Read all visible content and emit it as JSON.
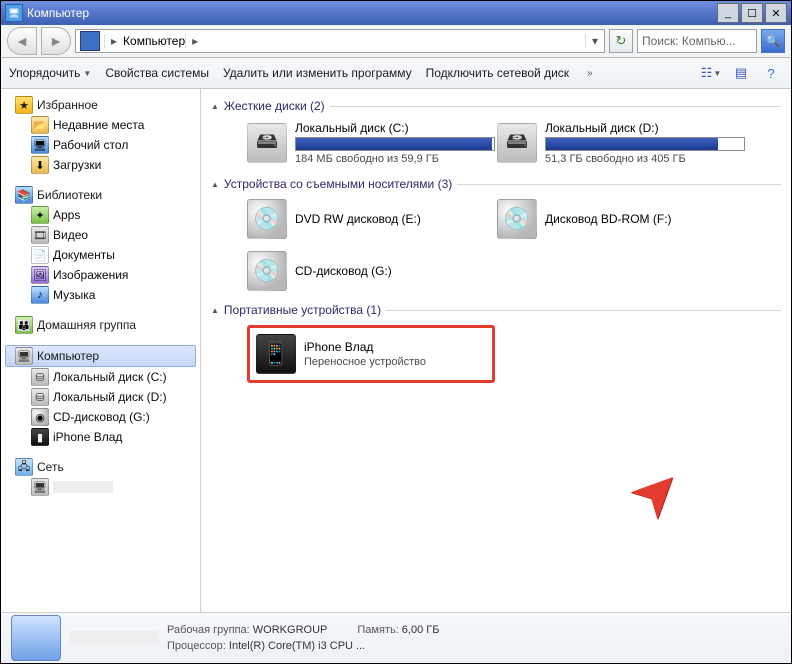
{
  "window": {
    "title": "Компьютер"
  },
  "address": {
    "text": "Компьютер",
    "search_placeholder": "Поиск: Компью..."
  },
  "toolbar": {
    "organize": "Упорядочить",
    "sysprops": "Свойства системы",
    "uninstall": "Удалить или изменить программу",
    "mapdrive": "Подключить сетевой диск"
  },
  "sidebar": {
    "fav_header": "Избранное",
    "fav_items": [
      "Недавние места",
      "Рабочий стол",
      "Загрузки"
    ],
    "lib_header": "Библиотеки",
    "lib_items": [
      "Apps",
      "Видео",
      "Документы",
      "Изображения",
      "Музыка"
    ],
    "homegroup": "Домашняя группа",
    "computer": "Компьютер",
    "drives": [
      "Локальный диск (C:)",
      "Локальный диск (D:)",
      "CD-дисковод (G:)",
      "iPhone Влад"
    ],
    "network": "Сеть"
  },
  "sections": {
    "hdd": "Жесткие диски (2)",
    "removable": "Устройства со съемными носителями (3)",
    "portable": "Портативные устройства (1)"
  },
  "hdds": [
    {
      "name": "Локальный диск (C:)",
      "free_text": "184 МБ свободно из 59,9 ГБ",
      "fill_pct": 99
    },
    {
      "name": "Локальный диск (D:)",
      "free_text": "51,3 ГБ свободно из 405 ГБ",
      "fill_pct": 87
    }
  ],
  "removables": [
    {
      "name": "DVD RW дисковод (E:)"
    },
    {
      "name": "Дисковод BD-ROM (F:)"
    },
    {
      "name": "CD-дисковод (G:)"
    }
  ],
  "portable": {
    "name": "iPhone Влад",
    "sub": "Переносное устройство"
  },
  "details": {
    "workgroup_label": "Рабочая группа:",
    "workgroup": "WORKGROUP",
    "memory_label": "Память:",
    "memory": "6,00 ГБ",
    "cpu_label": "Процессор:",
    "cpu": "Intel(R) Core(TM) i3 CPU  ..."
  }
}
